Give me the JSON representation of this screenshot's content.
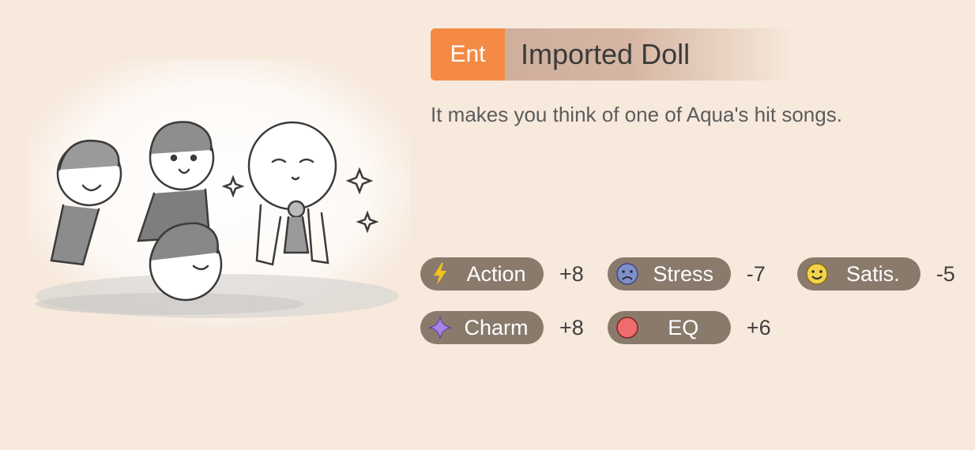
{
  "item": {
    "category": "Ent",
    "name": "Imported Doll",
    "description": "It makes you think of one of Aqua's hit songs.",
    "illustration_icon": "doll-scene-illustration"
  },
  "stats": [
    {
      "label": "Action",
      "value": "+8",
      "icon": "lightning-icon",
      "color": "#f4c21c"
    },
    {
      "label": "Stress",
      "value": "-7",
      "icon": "sad-face-icon",
      "color": "#7f8fc9"
    },
    {
      "label": "Satis.",
      "value": "-5",
      "icon": "smile-face-icon",
      "color": "#f2d34a"
    },
    {
      "label": "Charm",
      "value": "+8",
      "icon": "sparkle-icon",
      "color": "#a883e8"
    },
    {
      "label": "EQ",
      "value": "+6",
      "icon": "red-circle-icon",
      "color": "#f06b6b"
    }
  ],
  "colors": {
    "background": "#f7e9dc",
    "category_badge": "#f48a43",
    "stat_pill": "#8a7a6c"
  }
}
